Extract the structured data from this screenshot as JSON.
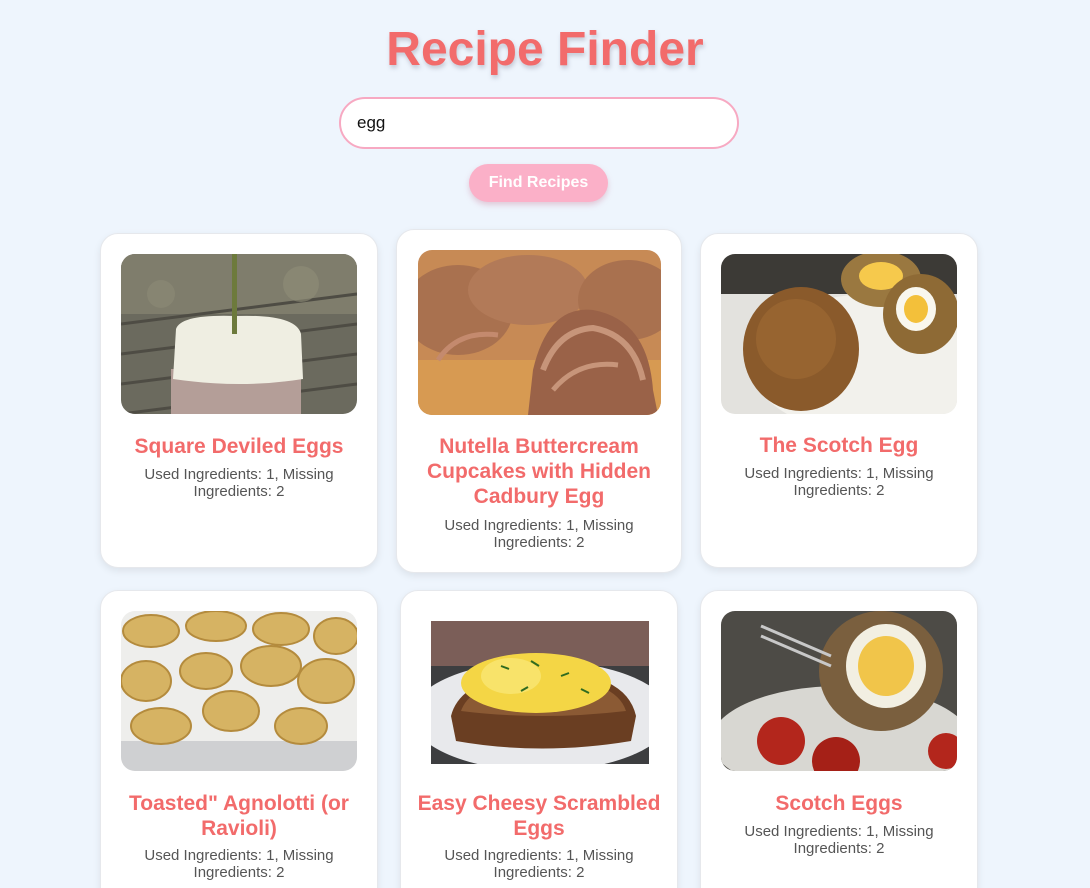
{
  "app": {
    "title": "Recipe Finder"
  },
  "search": {
    "value": "egg",
    "button_label": "Find Recipes"
  },
  "recipes": [
    {
      "name": "Square Deviled Eggs",
      "info": "Used Ingredients: 1, Missing Ingredients: 2",
      "image": "deviled-egg-photo"
    },
    {
      "name": "Nutella Buttercream Cupcakes with Hidden Cadbury Egg",
      "info": "Used Ingredients: 1, Missing Ingredients: 2",
      "image": "cupcakes-photo"
    },
    {
      "name": "The Scotch Egg",
      "info": "Used Ingredients: 1, Missing Ingredients: 2",
      "image": "scotch-egg-photo"
    },
    {
      "name": "Toasted\" Agnolotti (or Ravioli)",
      "info": "Used Ingredients: 1, Missing Ingredients: 2",
      "image": "agnolotti-photo"
    },
    {
      "name": "Easy Cheesy Scrambled Eggs",
      "info": "Used Ingredients: 1, Missing Ingredients: 2",
      "image": "scrambled-eggs-photo"
    },
    {
      "name": "Scotch Eggs",
      "info": "Used Ingredients: 1, Missing Ingredients: 2",
      "image": "scotch-eggs-photo"
    }
  ],
  "colors": {
    "accent": "#f26b6b",
    "button": "#fbb0c8",
    "background": "#eef5fd"
  }
}
